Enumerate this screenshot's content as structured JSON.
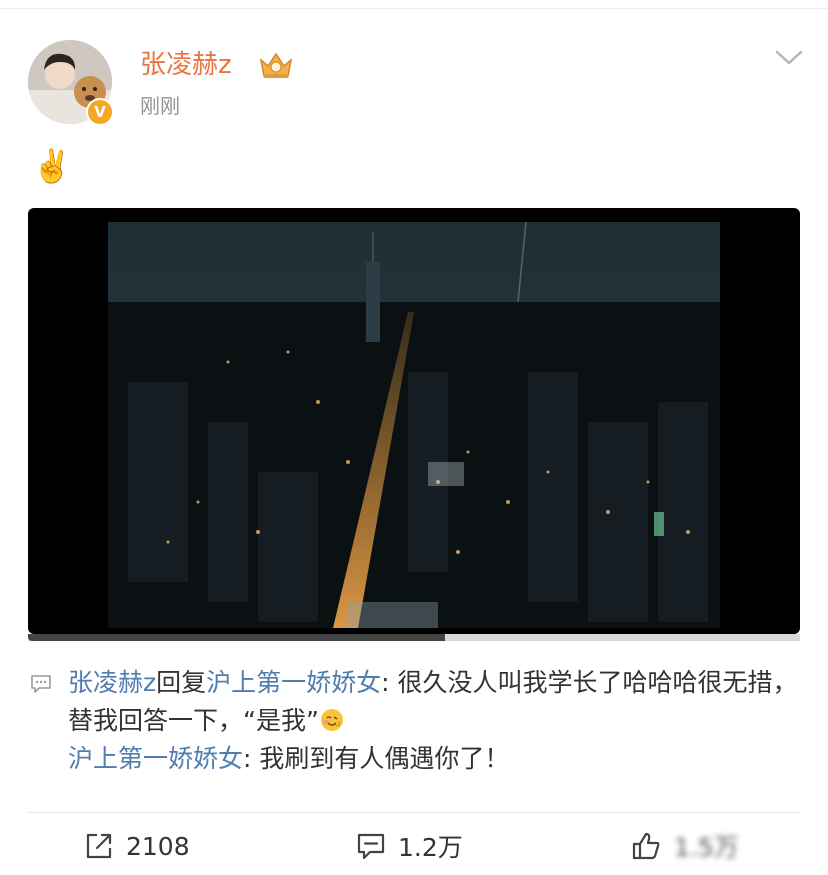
{
  "post": {
    "author": {
      "name": "张凌赫z",
      "verified_letter": "V"
    },
    "timestamp": "刚刚",
    "text": "✌️"
  },
  "video": {
    "progress_fraction": 0.54
  },
  "comment": {
    "replier": "张凌赫z",
    "reply_word": "回复",
    "reply_to": "沪上第一娇娇女",
    "reply_text": ": 很久没人叫我学长了哈哈哈很无措，替我回答一下，“是我”",
    "orig_user": "沪上第一娇娇女",
    "orig_text": ": 我刷到有人偶遇你了！"
  },
  "actions": {
    "repost_count": "2108",
    "comment_count": "1.2万",
    "like_count": "1.5万"
  },
  "colors": {
    "username": "#eb7340",
    "link": "#507daf",
    "verified": "#f5a623"
  },
  "icons": [
    "verified-badge-icon",
    "crown-badge-icon",
    "chevron-down-icon",
    "comment-bubble-icon",
    "emoji-icon",
    "repost-icon",
    "comment-icon",
    "like-icon"
  ]
}
